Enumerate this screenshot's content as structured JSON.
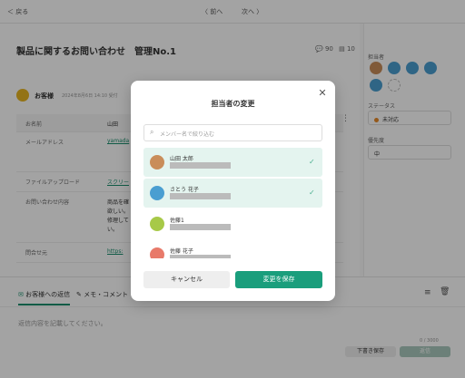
{
  "topbar": {
    "back": "＜ 戻る",
    "prev": "〈 前へ",
    "next": "次へ 〉"
  },
  "page": {
    "title": "製品に関するお問い合わせ　管理No.1",
    "comments": "90",
    "attachments": "10"
  },
  "message": {
    "sender": "お客様",
    "time": "2024年8月6日 14:10 受付"
  },
  "table": {
    "rows": [
      {
        "label": "お名前",
        "value": "山田"
      },
      {
        "label": "メールアドレス",
        "value": "yamada"
      },
      {
        "label": "ファイルアップロード",
        "value": "スクリー"
      },
      {
        "label": "お問い合わせ内容",
        "value": "商品を確"
      },
      {
        "label": "",
        "value": "欲しい。"
      },
      {
        "label": "",
        "value": "修理して"
      },
      {
        "label": "",
        "value": "い。"
      },
      {
        "label": "問合せ元",
        "value": "https:"
      }
    ]
  },
  "sidebar": {
    "assignees_label": "担当者",
    "status_label": "ステータス",
    "status_value": "未対応",
    "priority_label": "優先度",
    "priority_value": "中"
  },
  "reply": {
    "tab_customer": "お客様への返信",
    "tab_memo": "メモ・コメント",
    "placeholder": "返信内容を記載してください。",
    "counter": "0 / 3000",
    "draft": "下書き保存",
    "send": "返信"
  },
  "modal": {
    "title": "担当者の変更",
    "search_placeholder": "メンバー名で絞り込む",
    "members": [
      {
        "name": "山田 太郎",
        "selected": true
      },
      {
        "name": "さとう 花子",
        "selected": true
      },
      {
        "name": "佐藤1",
        "selected": false
      },
      {
        "name": "佐藤 花子",
        "selected": false
      }
    ],
    "cancel": "キャンセル",
    "save": "変更を保存"
  },
  "colors": {
    "accent": "#1a9e7c",
    "selected_bg": "#e4f4ef",
    "status_dot": "#e88a2a"
  }
}
